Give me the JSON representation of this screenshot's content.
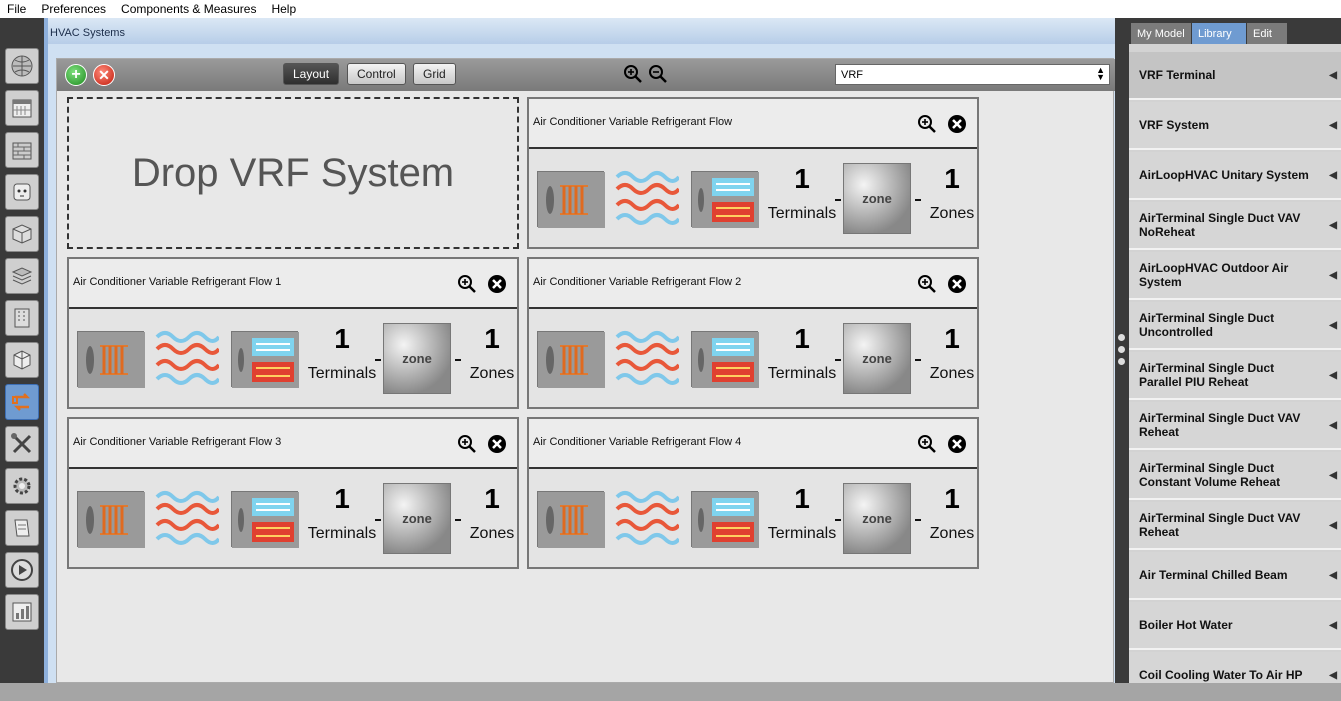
{
  "menu": [
    "File",
    "Preferences",
    "Components & Measures",
    "Help"
  ],
  "main": {
    "title": "HVAC Systems",
    "toolbar": {
      "layout_label": "Layout",
      "control_label": "Control",
      "grid_label": "Grid",
      "system_select_value": "VRF"
    },
    "drop_zone_text": "Drop VRF System",
    "systems": [
      {
        "name": "Air Conditioner Variable Refrigerant Flow",
        "terminals": "1",
        "terminals_label": "Terminals",
        "zone_label": "zone",
        "zones": "1",
        "zones_label": "Zones"
      },
      {
        "name": "Air Conditioner Variable Refrigerant Flow 1",
        "terminals": "1",
        "terminals_label": "Terminals",
        "zone_label": "zone",
        "zones": "1",
        "zones_label": "Zones"
      },
      {
        "name": "Air Conditioner Variable Refrigerant Flow 2",
        "terminals": "1",
        "terminals_label": "Terminals",
        "zone_label": "zone",
        "zones": "1",
        "zones_label": "Zones"
      },
      {
        "name": "Air Conditioner Variable Refrigerant Flow 3",
        "terminals": "1",
        "terminals_label": "Terminals",
        "zone_label": "zone",
        "zones": "1",
        "zones_label": "Zones"
      },
      {
        "name": "Air Conditioner Variable Refrigerant Flow 4",
        "terminals": "1",
        "terminals_label": "Terminals",
        "zone_label": "zone",
        "zones": "1",
        "zones_label": "Zones"
      }
    ]
  },
  "right": {
    "tabs": [
      "My Model",
      "Library",
      "Edit"
    ],
    "active_tab": "Library",
    "items": [
      "VRF Terminal",
      "VRF System",
      "AirLoopHVAC Unitary System",
      "AirTerminal Single Duct VAV NoReheat",
      "AirLoopHVAC Outdoor Air System",
      "AirTerminal Single Duct Uncontrolled",
      "AirTerminal Single Duct Parallel PIU Reheat",
      "AirTerminal Single Duct VAV Reheat",
      "AirTerminal Single Duct Constant Volume Reheat",
      "AirTerminal Single Duct VAV Reheat",
      "Air Terminal Chilled Beam",
      "Boiler Hot Water",
      "Coil Cooling Water To Air HP"
    ]
  },
  "left_tabs": [
    "site-icon",
    "schedules-icon",
    "constructions-icon",
    "loads-icon",
    "space-types-icon",
    "geometry-icon",
    "facility-icon",
    "spaces-icon",
    "hvac-systems-icon",
    "measures-icon",
    "simulation-settings-icon",
    "scripts-icon",
    "run-icon",
    "results-icon"
  ],
  "left_active": "hvac-systems-icon",
  "colors": {
    "accent": "#6f9bd1",
    "title_bar": "#b7cde8",
    "panel_dark": "#3a3a3a"
  }
}
